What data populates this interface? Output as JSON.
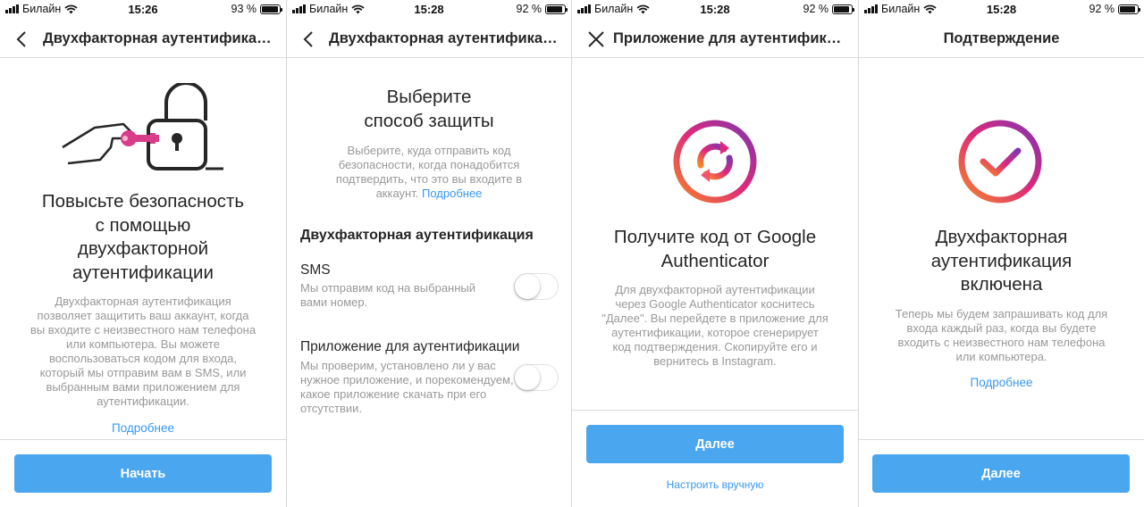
{
  "screens": [
    {
      "status": {
        "carrier": "Билайн",
        "time": "15:26",
        "battery": "93 %",
        "battery_level": 0.93
      },
      "nav_title": "Двухфакторная аутентификация",
      "title_lines": [
        "Повысьте безопасность",
        "с помощью",
        "двухфакторной",
        "аутентификации"
      ],
      "description_lines": [
        "Двухфакторная аутентификация",
        "позволяет защитить ваш аккаунт, когда",
        "вы входите с неизвестного нам телефона",
        "или компьютера. Вы можете",
        "воспользоваться кодом для входа,",
        "который мы отправим вам в SMS, или",
        "выбранным вами приложением для",
        "аутентификации."
      ],
      "learn_more": "Подробнее",
      "button": "Начать"
    },
    {
      "status": {
        "carrier": "Билайн",
        "time": "15:28",
        "battery": "92 %",
        "battery_level": 0.92
      },
      "nav_title": "Двухфакторная аутентификация",
      "title_lines": [
        "Выберите",
        "способ защиты"
      ],
      "description_lines": [
        "Выберите, куда отправить код",
        "безопасности, когда понадобится",
        "подтвердить, что это вы входите в"
      ],
      "description_last": "аккаунт.",
      "learn_more": "Подробнее",
      "section_header": "Двухфакторная аутентификация",
      "options": [
        {
          "title": "SMS",
          "description_lines": [
            "Мы отправим код на выбранный",
            "вами номер."
          ],
          "enabled": false
        },
        {
          "title": "Приложение для аутентификации",
          "description_lines": [
            "Мы проверим, установлено ли у вас",
            "нужное приложение, и порекомендуем,",
            "какое приложение скачать при его",
            "отсутствии."
          ],
          "enabled": false
        }
      ]
    },
    {
      "status": {
        "carrier": "Билайн",
        "time": "15:28",
        "battery": "92 %",
        "battery_level": 0.92
      },
      "nav_title": "Приложение для аутентификации",
      "title_lines": [
        "Получите код от Google",
        "Authenticator"
      ],
      "description_lines": [
        "Для двухфакторной аутентификации",
        "через Google Authenticator коснитесь",
        "\"Далее\". Вы перейдете в приложение для",
        "аутентификации, которое сгенерирует",
        "код подтверждения. Скопируйте его и",
        "вернитесь в Instagram."
      ],
      "button": "Далее",
      "secondary_link": "Настроить вручную"
    },
    {
      "status": {
        "carrier": "Билайн",
        "time": "15:28",
        "battery": "92 %",
        "battery_level": 0.92
      },
      "nav_title": "Подтверждение",
      "title_lines": [
        "Двухфакторная",
        "аутентификация",
        "включена"
      ],
      "description_lines": [
        "Теперь мы будем запрашивать код для",
        "входа каждый раз, когда вы будете",
        "входить с неизвестного нам телефона",
        "или компьютера."
      ],
      "learn_more": "Подробнее",
      "button": "Далее"
    }
  ],
  "colors": {
    "accent": "#3897f0",
    "button": "#4aa6ee",
    "gradient_start": "#f58529",
    "gradient_mid": "#dd2a7b",
    "gradient_end": "#8134af"
  },
  "icons": {
    "back": "chevron-left-icon",
    "close": "close-icon",
    "sync": "sync-icon",
    "check": "check-icon",
    "lock": "padlock-illustration"
  }
}
